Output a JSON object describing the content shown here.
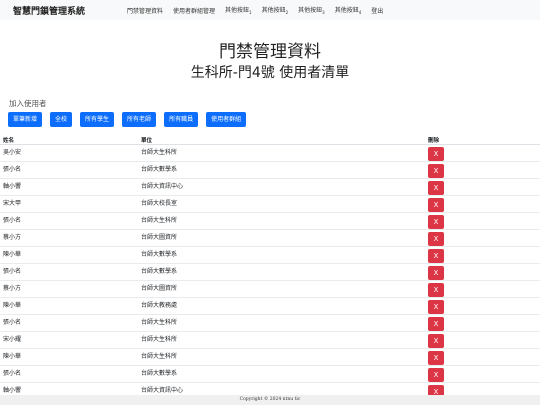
{
  "navbar": {
    "brand": "智慧門鎖管理系統",
    "items": [
      {
        "label": "門禁管理資料"
      },
      {
        "label": "使用者群組管理"
      },
      {
        "label": "其他按鈕",
        "num": "1"
      },
      {
        "label": "其他按鈕",
        "num": "2"
      },
      {
        "label": "其他按鈕",
        "num": "3"
      },
      {
        "label": "其他按鈕",
        "num": "4"
      },
      {
        "label": "登出"
      }
    ]
  },
  "hero": {
    "title": "門禁管理資料",
    "subtitle": "生科所-門4號 使用者清單"
  },
  "add_section": {
    "label": "加入使用者",
    "buttons": [
      {
        "label": "單筆新增"
      },
      {
        "label": "全校"
      },
      {
        "label": "所有學生"
      },
      {
        "label": "所有老師"
      },
      {
        "label": "所有職員"
      },
      {
        "label": "使用者群組"
      }
    ]
  },
  "table": {
    "headers": {
      "name": "姓名",
      "unit": "單位",
      "delete": "刪除"
    },
    "delete_label": "X",
    "rows": [
      {
        "name": "吳小安",
        "unit": "台師大生科所"
      },
      {
        "name": "張小名",
        "unit": "台師大數學系"
      },
      {
        "name": "軸小響",
        "unit": "台師大資訊中心"
      },
      {
        "name": "宋大甲",
        "unit": "台師大校長室"
      },
      {
        "name": "張小名",
        "unit": "台師大生科所"
      },
      {
        "name": "蔡小方",
        "unit": "台師大圖資所"
      },
      {
        "name": "陳小華",
        "unit": "台師大數學系"
      },
      {
        "name": "張小名",
        "unit": "台師大數學系"
      },
      {
        "name": "蔡小方",
        "unit": "台師大圖資所"
      },
      {
        "name": "陳小華",
        "unit": "台師大教務處"
      },
      {
        "name": "張小名",
        "unit": "台師大生科所"
      },
      {
        "name": "宋小耀",
        "unit": "台師大生科所"
      },
      {
        "name": "陳小華",
        "unit": "台師大生科所"
      },
      {
        "name": "張小名",
        "unit": "台師大數學系"
      },
      {
        "name": "軸小響",
        "unit": "台師大資訊中心"
      }
    ]
  },
  "footer": {
    "text": "Copyright © 2024 ntnu tic"
  }
}
